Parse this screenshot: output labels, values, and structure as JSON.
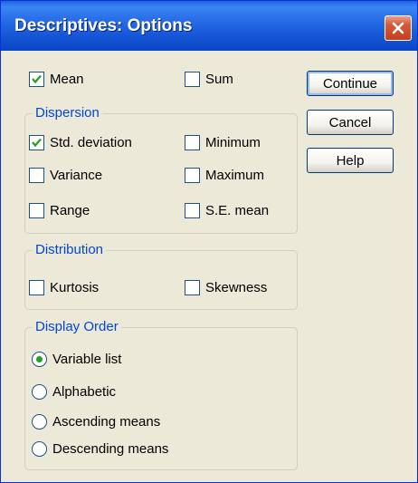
{
  "window": {
    "title": "Descriptives: Options"
  },
  "stats": {
    "mean": {
      "label": "Mean",
      "checked": true
    },
    "sum": {
      "label": "Sum",
      "checked": false
    }
  },
  "dispersion": {
    "title": "Dispersion",
    "std_deviation": {
      "label": "Std. deviation",
      "checked": true
    },
    "minimum": {
      "label": "Minimum",
      "checked": false
    },
    "variance": {
      "label": "Variance",
      "checked": false
    },
    "maximum": {
      "label": "Maximum",
      "checked": false
    },
    "range": {
      "label": "Range",
      "checked": false
    },
    "se_mean": {
      "label": "S.E. mean",
      "checked": false
    }
  },
  "distribution": {
    "title": "Distribution",
    "kurtosis": {
      "label": "Kurtosis",
      "checked": false
    },
    "skewness": {
      "label": "Skewness",
      "checked": false
    }
  },
  "display_order": {
    "title": "Display Order",
    "selected": "Variable list",
    "options": [
      "Variable list",
      "Alphabetic",
      "Ascending means",
      "Descending means"
    ]
  },
  "buttons": {
    "continue": "Continue",
    "cancel": "Cancel",
    "help": "Help"
  },
  "colors": {
    "titlebar": "#2B6FE8",
    "group_title": "#0046D5",
    "checkmark": "#21A121",
    "face": "#ECE9D8"
  }
}
